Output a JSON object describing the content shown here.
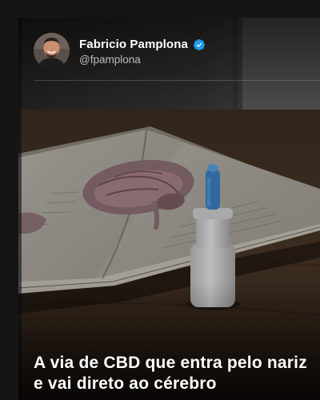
{
  "post": {
    "author": {
      "display_name": "Fabricio Pamplona",
      "handle": "@fpamplona",
      "verified": true
    },
    "image_description_icon": "nasal-spray-bottle-on-open-brain-anatomy-book",
    "headline": "A via de CBD que entra pelo nariz e vai direto ao cérebro"
  },
  "colors": {
    "page_background": "#151515",
    "verified_badge": "#1d9bf0",
    "headline_text": "#ffffff",
    "handle_text": "#bdbdbd"
  }
}
